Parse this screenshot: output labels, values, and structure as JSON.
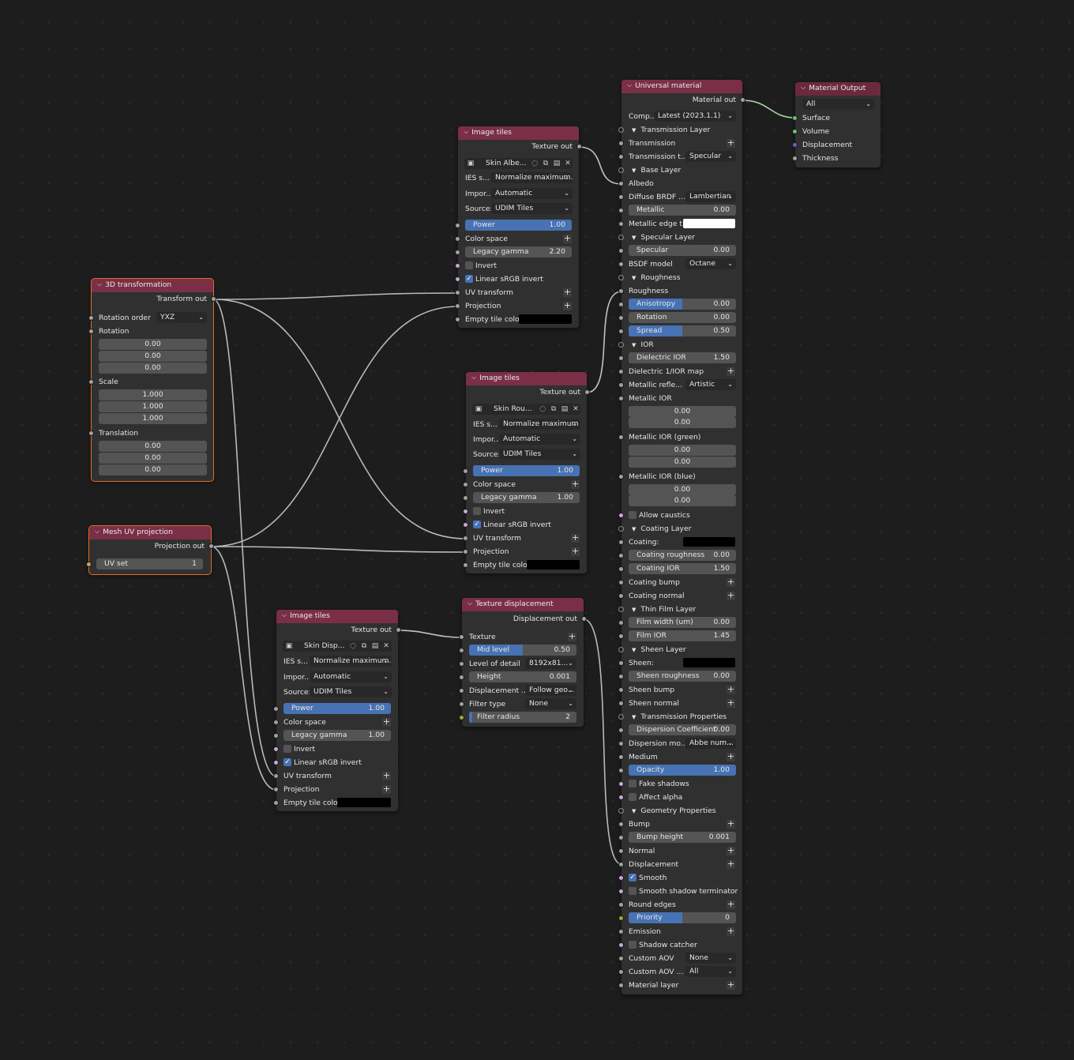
{
  "theme": {
    "socket_grey": "#a1a1a1",
    "socket_vector": "#6363c7",
    "socket_shader": "#63c763",
    "header": "#7a2f46",
    "field_fill": "#4772b3"
  },
  "transform3d": {
    "title": "3D transformation",
    "out": "Transform out",
    "rotation_order_label": "Rotation order",
    "rotation_order": "YXZ",
    "rotation_label": "Rotation",
    "rotation": [
      "0.00",
      "0.00",
      "0.00"
    ],
    "scale_label": "Scale",
    "scale": [
      "1.000",
      "1.000",
      "1.000"
    ],
    "translation_label": "Translation",
    "translation": [
      "0.00",
      "0.00",
      "0.00"
    ]
  },
  "meshuv": {
    "title": "Mesh UV projection",
    "out": "Projection out",
    "uvset_label": "UV set",
    "uvset": "1"
  },
  "tiles1": {
    "title": "Image tiles",
    "out": "Texture out",
    "image": "Skin Albe...",
    "ies_label": "IES s...",
    "ies": "Normalize maximum...",
    "import_label": "Impor...",
    "import": "Automatic",
    "source_label": "Source:",
    "source": "UDIM Tiles",
    "power_label": "Power",
    "power": "1.00",
    "colorspace": "Color space",
    "gamma_label": "Legacy gamma",
    "gamma": "2.20",
    "invert": "Invert",
    "linear": "Linear sRGB invert",
    "uv": "UV transform",
    "proj": "Projection",
    "empty": "Empty tile color:"
  },
  "tiles2": {
    "title": "Image tiles",
    "out": "Texture out",
    "image": "Skin Rou...",
    "ies_label": "IES s...",
    "ies": "Normalize maximum ...",
    "import_label": "Impor...",
    "import": "Automatic",
    "source_label": "Source:",
    "source": "UDIM Tiles",
    "power_label": "Power",
    "power": "1.00",
    "colorspace": "Color space",
    "gamma_label": "Legacy gamma",
    "gamma": "1.00",
    "invert": "Invert",
    "linear": "Linear sRGB invert",
    "uv": "UV transform",
    "proj": "Projection",
    "empty": "Empty tile color:"
  },
  "tiles3": {
    "title": "Image tiles",
    "out": "Texture out",
    "image": "Skin Disp...",
    "ies_label": "IES s...",
    "ies": "Normalize maximum...",
    "import_label": "Impor...",
    "import": "Automatic",
    "source_label": "Source:",
    "source": "UDIM Tiles",
    "power_label": "Power",
    "power": "1.00",
    "colorspace": "Color space",
    "gamma_label": "Legacy gamma",
    "gamma": "1.00",
    "invert": "Invert",
    "linear": "Linear sRGB invert",
    "uv": "UV transform",
    "proj": "Projection",
    "empty": "Empty tile color:"
  },
  "texdisp": {
    "title": "Texture displacement",
    "out": "Displacement out",
    "texture": "Texture",
    "mid_label": "Mid level",
    "mid": "0.50",
    "lod_label": "Level of detail",
    "lod": "8192x81...",
    "height_label": "Height",
    "height": "0.001",
    "disp_label": "Displacement ...",
    "disp": "Follow geo...",
    "filter_label": "Filter type",
    "filter": "None",
    "radius_label": "Filter radius",
    "radius": "2"
  },
  "universal": {
    "title": "Universal material",
    "out": "Material out",
    "comp_label": "Comp...",
    "comp": "Latest (2023.1.1)",
    "rows": [
      "Transmission Layer",
      "Transmission",
      "Transmission t...",
      "Specular",
      "Base Layer",
      "Albedo",
      "Diffuse BRDF ...",
      "Lambertian",
      "Metallic",
      "0.00",
      "Metallic edge t...",
      "Specular Layer",
      "Specular",
      "0.00",
      "BSDF model",
      "Octane",
      "Roughness",
      "Roughness",
      "Anisotropy",
      "0.00",
      "Rotation",
      "0.00",
      "Spread",
      "0.50",
      "IOR",
      "Dielectric IOR",
      "1.50",
      "Dielectric 1/IOR map",
      "Metallic refle...",
      "Artistic",
      "Metallic IOR",
      "0.00",
      "0.00",
      "Metallic IOR (green)",
      "0.00",
      "0.00",
      "Metallic IOR (blue)",
      "0.00",
      "0.00",
      "Allow caustics",
      "Coating Layer",
      "Coating:",
      "Coating roughness",
      "0.00",
      "Coating IOR",
      "1.50",
      "Coating bump",
      "Coating normal",
      "Thin Film Layer",
      "Film width (um)",
      "0.00",
      "Film IOR",
      "1.45",
      "Sheen Layer",
      "Sheen:",
      "Sheen roughness",
      "0.00",
      "Sheen bump",
      "Sheen normal",
      "Transmission Properties",
      "Dispersion Coefficient",
      "0.00",
      "Dispersion mo...",
      "Abbe num...",
      "Medium",
      "Opacity",
      "1.00",
      "Fake shadows",
      "Affect alpha",
      "Geometry Properties",
      "Bump",
      "Bump height",
      "0.001",
      "Normal",
      "Displacement",
      "Smooth",
      "Smooth shadow terminator",
      "Round edges",
      "Priority",
      "0",
      "Emission",
      "Shadow catcher",
      "Custom AOV",
      "None",
      "Custom AOV ...",
      "All",
      "Material layer"
    ]
  },
  "output": {
    "title": "Material Output",
    "target": "All",
    "surface": "Surface",
    "volume": "Volume",
    "displacement": "Displacement",
    "thickness": "Thickness"
  }
}
